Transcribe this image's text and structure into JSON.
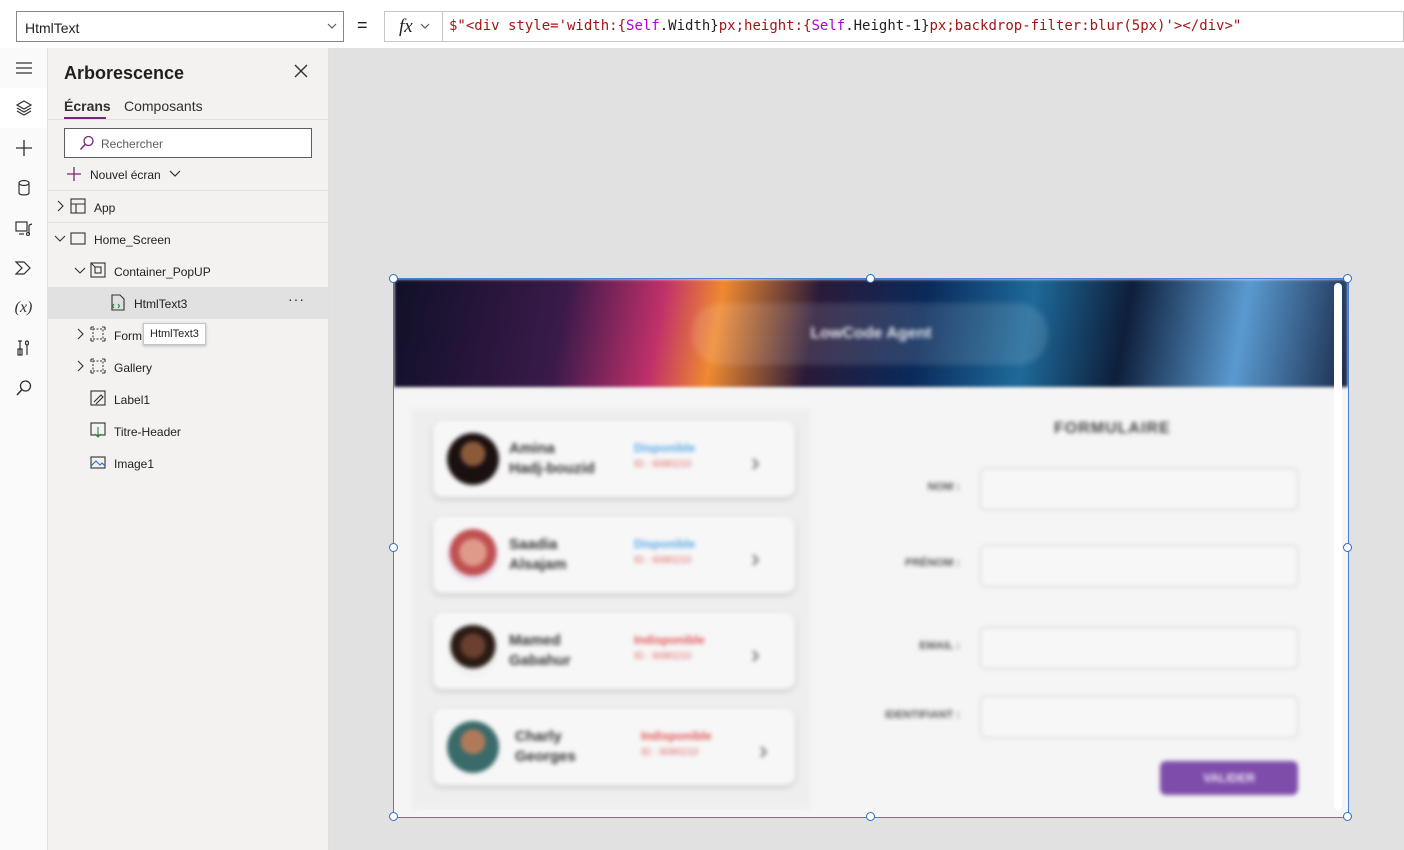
{
  "formula_bar": {
    "property": "HtmlText",
    "equals": "=",
    "fx_label": "fx",
    "formula_tokens": [
      {
        "text": "$\"<div style='width:{",
        "kind": "str"
      },
      {
        "text": "Self",
        "kind": "self"
      },
      {
        "text": ".Width}",
        "kind": "plain"
      },
      {
        "text": "px;height:{",
        "kind": "str"
      },
      {
        "text": "Self",
        "kind": "self"
      },
      {
        "text": ".Height-1}",
        "kind": "plain"
      },
      {
        "text": "px;backdrop-filter:blur(5px)'></div>\"",
        "kind": "str"
      }
    ]
  },
  "rail": {
    "items": [
      {
        "name": "menu-icon",
        "active": false
      },
      {
        "name": "layers-icon",
        "active": true
      },
      {
        "name": "insert-plus-icon",
        "active": false
      },
      {
        "name": "data-icon",
        "active": false
      },
      {
        "name": "media-icon",
        "active": false
      },
      {
        "name": "power-automate-icon",
        "active": false
      },
      {
        "name": "variables-icon",
        "active": false
      },
      {
        "name": "tools-icon",
        "active": false
      },
      {
        "name": "search-icon",
        "active": false
      }
    ],
    "variables_glyph": "(x)"
  },
  "tree_panel": {
    "title": "Arborescence",
    "tabs": [
      {
        "label": "Écrans",
        "active": true
      },
      {
        "label": "Composants",
        "active": false
      }
    ],
    "search_placeholder": "Rechercher",
    "new_screen_label": "Nouvel écran",
    "rows": [
      {
        "label": "App",
        "icon": "app-icon",
        "indent": 0,
        "expander": "right",
        "selected": false
      },
      {
        "label": "Home_Screen",
        "icon": "screen-icon",
        "indent": 0,
        "expander": "down",
        "selected": false
      },
      {
        "label": "Container_PopUP",
        "icon": "container-icon",
        "indent": 1,
        "expander": "down",
        "selected": false
      },
      {
        "label": "HtmlText3",
        "icon": "html-text-icon",
        "indent": 2,
        "expander": "none",
        "selected": true
      },
      {
        "label": "Form",
        "icon": "form-icon",
        "indent": 1,
        "expander": "right",
        "selected": false
      },
      {
        "label": "Gallery",
        "icon": "gallery-icon",
        "indent": 1,
        "expander": "right",
        "selected": false
      },
      {
        "label": "Label1",
        "icon": "label-icon",
        "indent": 1,
        "expander": "none",
        "selected": false
      },
      {
        "label": "Titre-Header",
        "icon": "html-text-icon",
        "indent": 1,
        "expander": "none",
        "selected": false
      },
      {
        "label": "Image1",
        "icon": "image-icon",
        "indent": 1,
        "expander": "none",
        "selected": false
      }
    ],
    "more_label": "···",
    "tooltip": "HtmlText3"
  },
  "app_preview": {
    "header_title": "LowCode Agent",
    "cards": [
      {
        "name_line1": "Amina",
        "name_line2": "Hadj-bouzid",
        "status": "Disponible",
        "status_color": "#5aa9e6",
        "id": "ID : 6080210"
      },
      {
        "name_line1": "Saadia",
        "name_line2": "Alsajam",
        "status": "Disponible",
        "status_color": "#5aa9e6",
        "id": "ID : 6080210"
      },
      {
        "name_line1": "Mamed",
        "name_line2": "Gabahur",
        "status": "Indisponible",
        "status_color": "#e05555",
        "id": "ID : 6080210"
      },
      {
        "name_line1": "Charly",
        "name_line2": "Georges",
        "status": "Indisponible",
        "status_color": "#e05555",
        "id": "ID : 6080210"
      }
    ],
    "form_title": "FORMULAIRE",
    "fields": [
      {
        "label": "NOM :"
      },
      {
        "label": "PRÉNOM :"
      },
      {
        "label": "EMAIL :"
      },
      {
        "label": "IDENTIFIANT :"
      }
    ],
    "submit_label": "VALIDER"
  }
}
